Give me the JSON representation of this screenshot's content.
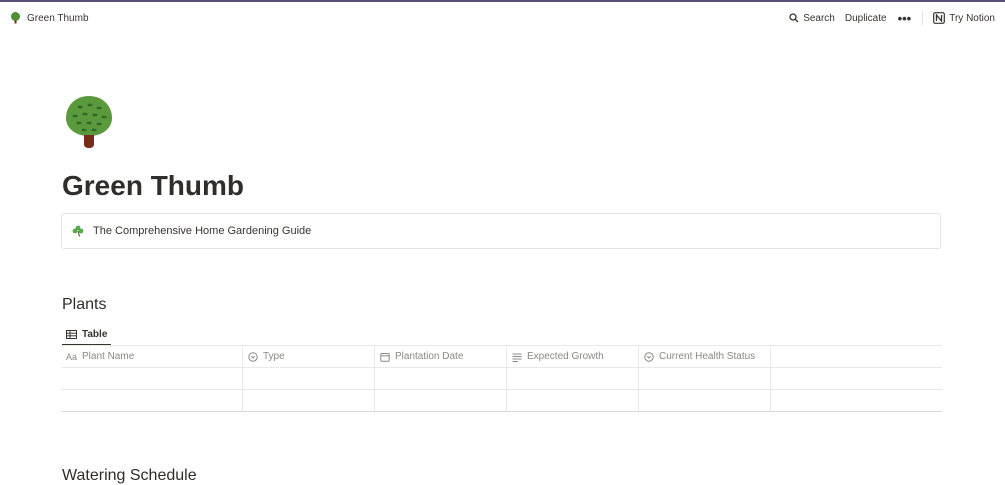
{
  "topbar": {
    "breadcrumb": "Green Thumb",
    "search_label": "Search",
    "duplicate_label": "Duplicate",
    "more_label": "•••",
    "try_notion_label": "Try Notion"
  },
  "page": {
    "icon": "tree-icon",
    "title": "Green Thumb",
    "callout_text": "The Comprehensive Home Gardening Guide",
    "callout_icon": "shamrock-icon"
  },
  "plants": {
    "title": "Plants",
    "view_tab": "Table",
    "columns": [
      {
        "label": "Plant Name",
        "icon": "text-aa-icon"
      },
      {
        "label": "Type",
        "icon": "select-icon"
      },
      {
        "label": "Plantation Date",
        "icon": "calendar-icon"
      },
      {
        "label": "Expected Growth",
        "icon": "lines-icon"
      },
      {
        "label": "Current Health Status",
        "icon": "select-icon"
      }
    ]
  },
  "watering": {
    "title": "Watering Schedule"
  },
  "colors": {
    "accent_topline": "#5b4f7a",
    "text": "#37352f",
    "muted": "#8a8985",
    "tree_green": "#5a9a3c",
    "trunk": "#7a2a1a"
  }
}
